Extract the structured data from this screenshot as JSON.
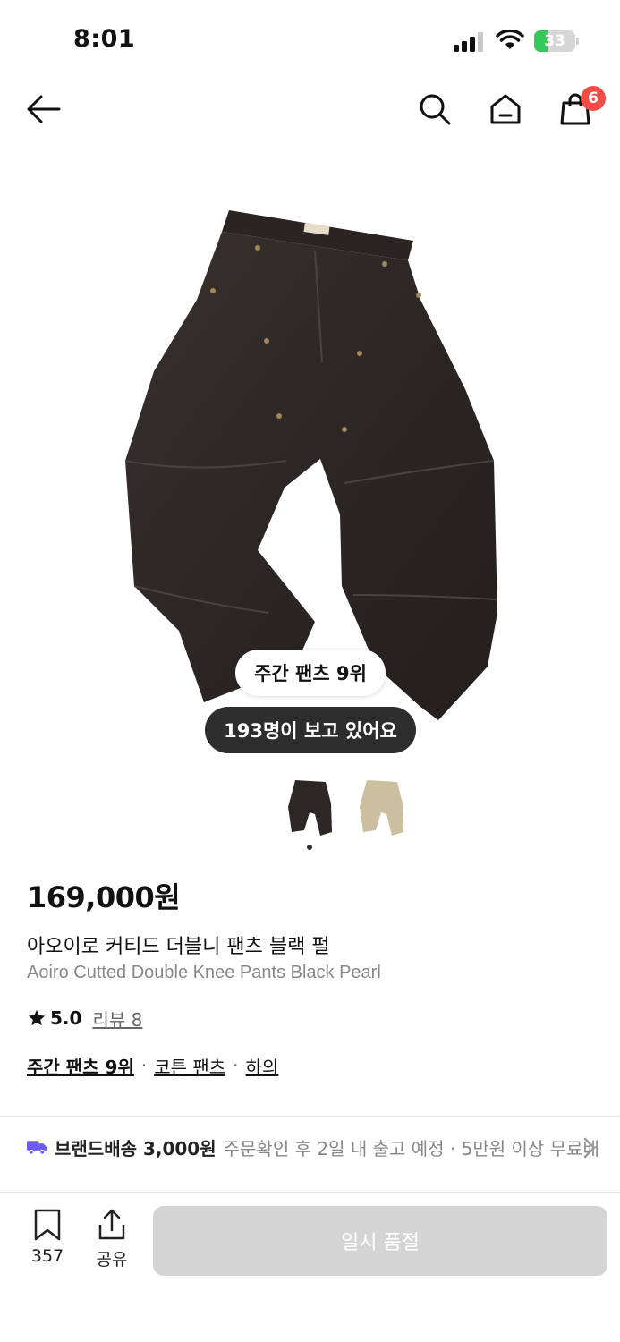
{
  "status_bar": {
    "time": "8:01",
    "battery_level": "33",
    "battery_fraction": 0.33
  },
  "nav": {
    "back_icon": "arrow-left-icon",
    "search_icon": "search-icon",
    "home_icon": "home-icon",
    "cart_icon": "shopping-bag-icon",
    "cart_count": "6"
  },
  "gallery": {
    "rank_badge": "주간 팬츠 9위",
    "viewers": "193명이 보고 있어요",
    "image_count": 2,
    "current_image": 1,
    "thumbnails": [
      {
        "name": "black-pants-thumbnail",
        "color": "#2c2624"
      },
      {
        "name": "beige-pants-thumbnail",
        "color": "#cbbf9f"
      }
    ]
  },
  "product": {
    "price": "169,000원",
    "name_ko": "아오이로 커티드 더블니 팬츠 블랙 펄",
    "name_en": "Aoiro Cutted Double Knee Pants Black Pearl",
    "rating": "5.0",
    "review_label": "리뷰 8",
    "categories": [
      "주간 팬츠 9위",
      "코튼 팬츠",
      "하의"
    ]
  },
  "shipping": {
    "label": "브랜드배송 3,000원",
    "note": "주문확인 후 2일 내 출고 예정 · 5만원 이상 무료배송",
    "icon": "truck-icon",
    "icon_color": "#6b5cf6"
  },
  "bottom_bar": {
    "bookmark_count": "357",
    "share_label": "공유",
    "buy_label": "일시 품절"
  },
  "colors": {
    "badge_red": "#f04e45",
    "disabled_button": "#d4d4d4",
    "pants_dark": "#2c2624"
  }
}
